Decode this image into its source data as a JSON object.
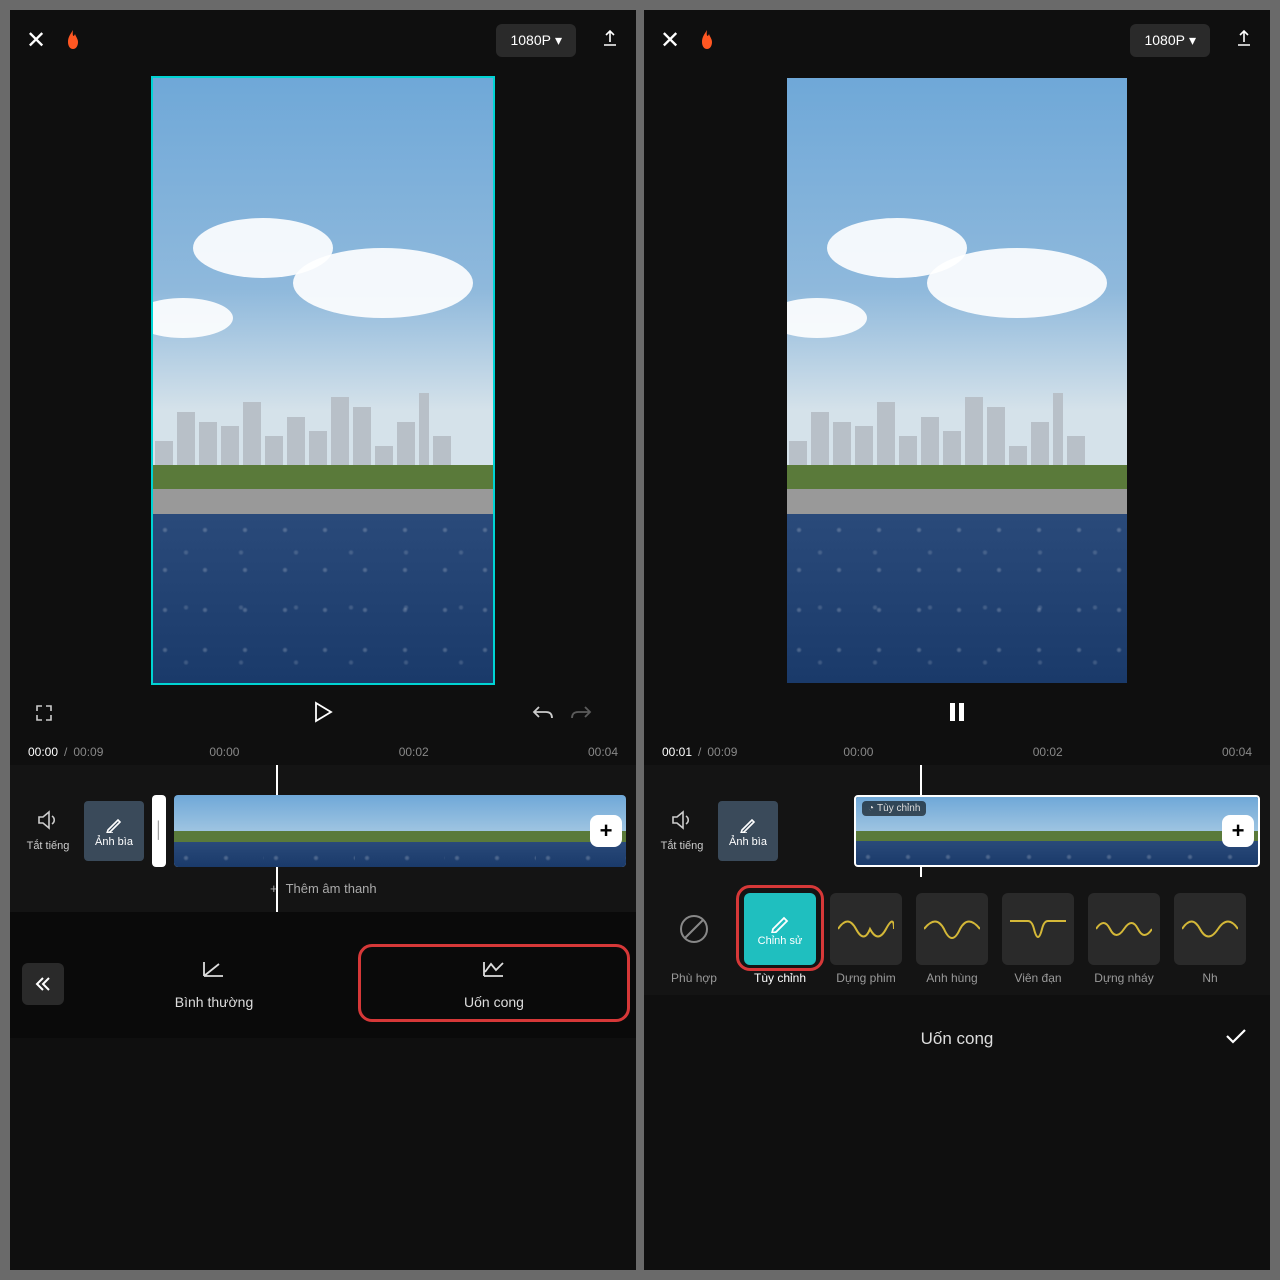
{
  "left": {
    "topbar": {
      "resolution": "1080P"
    },
    "time": {
      "current": "00:00",
      "total": "00:09",
      "ticks": [
        "00:00",
        "00:02",
        "00:04"
      ]
    },
    "timeline": {
      "mute": "Tắt tiếng",
      "cover": "Ảnh bìa",
      "addAudio": "Thêm âm thanh"
    },
    "tabs": {
      "normal": "Bình thường",
      "curve": "Uốn cong"
    }
  },
  "right": {
    "topbar": {
      "resolution": "1080P"
    },
    "time": {
      "current": "00:01",
      "total": "00:09",
      "ticks": [
        "00:00",
        "00:02",
        "00:04"
      ]
    },
    "timeline": {
      "mute": "Tắt tiếng",
      "cover": "Ảnh bìa",
      "clipTag": "Tùy chỉnh"
    },
    "presets": {
      "none": "Phù hợp",
      "custom": "Tùy chỉnh",
      "customEdit": "Chỉnh sử",
      "items": [
        "Dựng phim",
        "Anh hùng",
        "Viên đạn",
        "Dựng nháy",
        "Nh"
      ]
    },
    "confirm": "Uốn cong"
  }
}
